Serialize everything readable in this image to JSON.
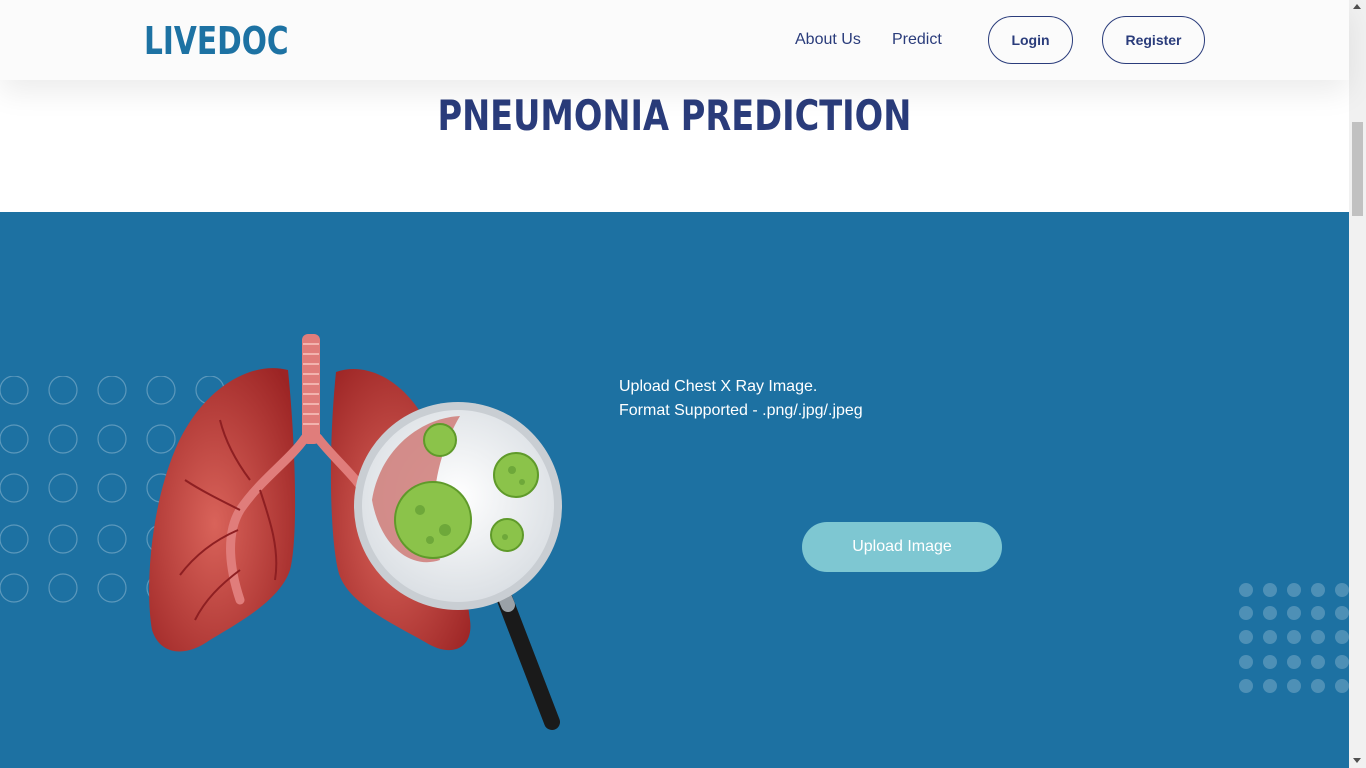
{
  "navbar": {
    "logo": "LIVEDOC",
    "links": [
      {
        "label": "About Us"
      },
      {
        "label": "Predict"
      }
    ],
    "login_label": "Login",
    "register_label": "Register"
  },
  "page": {
    "title": "PNEUMONIA PREDICTION"
  },
  "upload": {
    "instruction_line1": "Upload Chest X Ray Image.",
    "instruction_line2": "Format Supported - .png/.jpg/.jpeg",
    "button_label": "Upload Image"
  },
  "illustration": {
    "icon": "lungs-with-magnifier-virus-icon"
  },
  "colors": {
    "brand_blue": "#1d72a3",
    "navy": "#2a3c7b",
    "hero_background": "#1d71a2",
    "upload_button": "#7ec7d2",
    "lung_red": "#c0392b",
    "virus_green": "#8bc34a"
  }
}
